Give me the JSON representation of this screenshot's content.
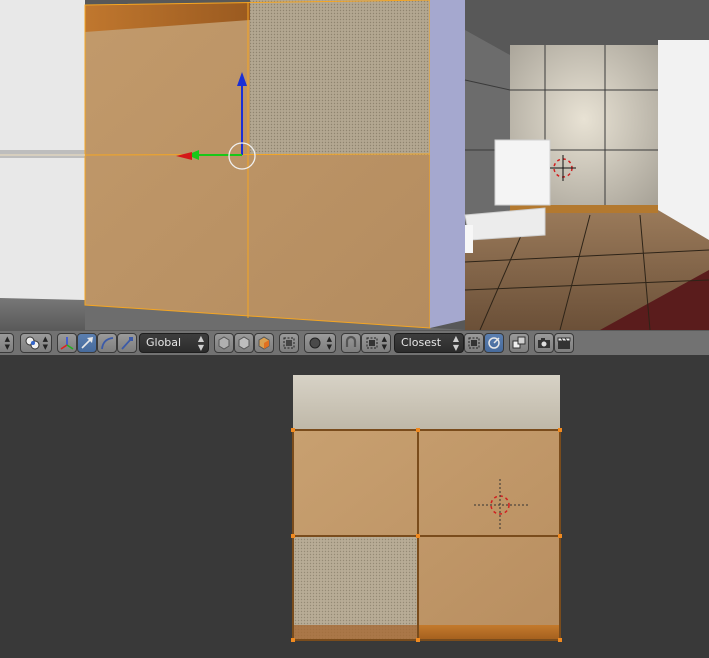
{
  "toolbar": {
    "transform_orientation": {
      "label": "Global",
      "options_visible": [
        "Global"
      ]
    },
    "snap_target": {
      "label": "Closest",
      "options_visible": [
        "Closest"
      ]
    }
  },
  "colors": {
    "selection_orange": "#f5a623",
    "wood_tile": "#c19a6b",
    "floor_red": "#5a1c1c",
    "toolbar_bg": "#727272",
    "editor_bg": "#393939",
    "active_blue": "#5b7fb0"
  }
}
